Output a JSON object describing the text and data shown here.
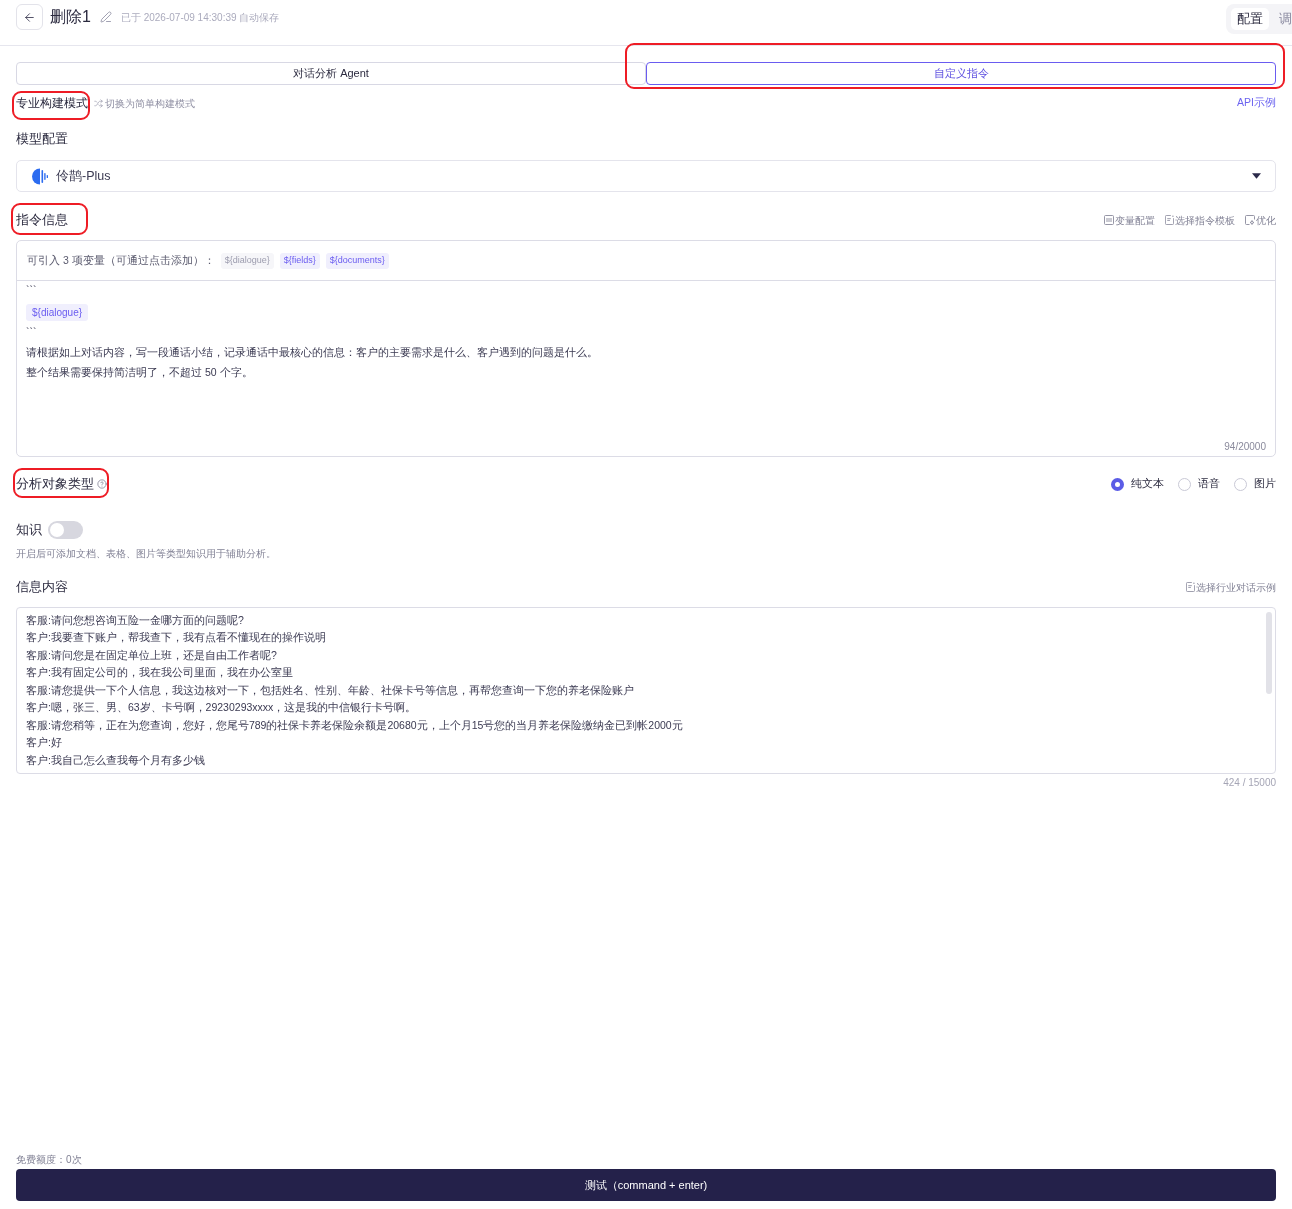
{
  "header": {
    "title": "删除1",
    "autosave": "已于 2026-07-09 14:30:39 自动保存",
    "view_tabs": [
      {
        "label": "配置",
        "selected": true
      },
      {
        "label": "调",
        "selected": false
      }
    ]
  },
  "mode_tabs": [
    {
      "label": "对话分析 Agent",
      "selected": false,
      "highlighted": false
    },
    {
      "label": "自定义指令",
      "selected": true,
      "highlighted": true
    }
  ],
  "build_mode": {
    "label": "专业构建模式",
    "highlighted": true,
    "switch_link": "切换为简单构建模式",
    "api_link": "API示例"
  },
  "model_config": {
    "label": "模型配置",
    "model": "伶鹊-Plus"
  },
  "instruction": {
    "label": "指令信息",
    "highlighted": true,
    "actions": [
      {
        "kind": "variables",
        "label": "变量配置"
      },
      {
        "kind": "template",
        "label": "选择指令模板"
      },
      {
        "kind": "optimize",
        "label": "优化"
      }
    ],
    "variables_hint": "可引入 3 项变量（可通过点击添加）：",
    "variables": [
      {
        "label": "${dialogue}",
        "disabled": true
      },
      {
        "label": "${fields}",
        "disabled": false
      },
      {
        "label": "${documents}",
        "disabled": false
      }
    ],
    "body": [
      {
        "kind": "text",
        "text": "```"
      },
      {
        "kind": "variable",
        "text": "${dialogue}"
      },
      {
        "kind": "text",
        "text": "```"
      },
      {
        "kind": "text",
        "text": "请根据如上对话内容，写一段通话小结，记录通话中最核心的信息：客户的主要需求是什么、客户遇到的问题是什么。"
      },
      {
        "kind": "text",
        "text": "整个结果需要保持简洁明了，不超过 50 个字。"
      }
    ],
    "counter": "94/20000"
  },
  "analysis_type": {
    "label": "分析对象类型",
    "highlighted": true,
    "options": [
      {
        "label": "纯文本",
        "selected": true
      },
      {
        "label": "语音",
        "selected": false
      },
      {
        "label": "图片",
        "selected": false
      }
    ]
  },
  "knowledge": {
    "label": "知识",
    "on": false,
    "description": "开启后可添加文档、表格、图片等类型知识用于辅助分析。"
  },
  "info_content": {
    "label": "信息内容",
    "example_link": "选择行业对话示例",
    "lines": [
      "客服:请问您想咨询五险一金哪方面的问题呢?",
      "客户:我要查下账户，帮我查下，我有点看不懂现在的操作说明",
      "客服:请问您是在固定单位上班，还是自由工作者呢?",
      "客户:我有固定公司的，我在我公司里面，我在办公室里",
      "客服:请您提供一下个人信息，我这边核对一下，包括姓名、性别、年龄、社保卡号等信息，再帮您查询一下您的养老保险账户",
      "客户:嗯，张三、男、63岁、卡号啊，29230293xxxx，这是我的中信银行卡号啊。",
      "客服:请您稍等，正在为您查询，您好，您尾号789的社保卡养老保险余额是20680元，上个月15号您的当月养老保险缴纳金已到帐2000元",
      "客户:好",
      "客户:我自己怎么查我每个月有多少钱"
    ],
    "counter": "424 / 15000"
  },
  "footer": {
    "quota": "免费额度：0次",
    "test_button": "测试（command + enter)"
  }
}
